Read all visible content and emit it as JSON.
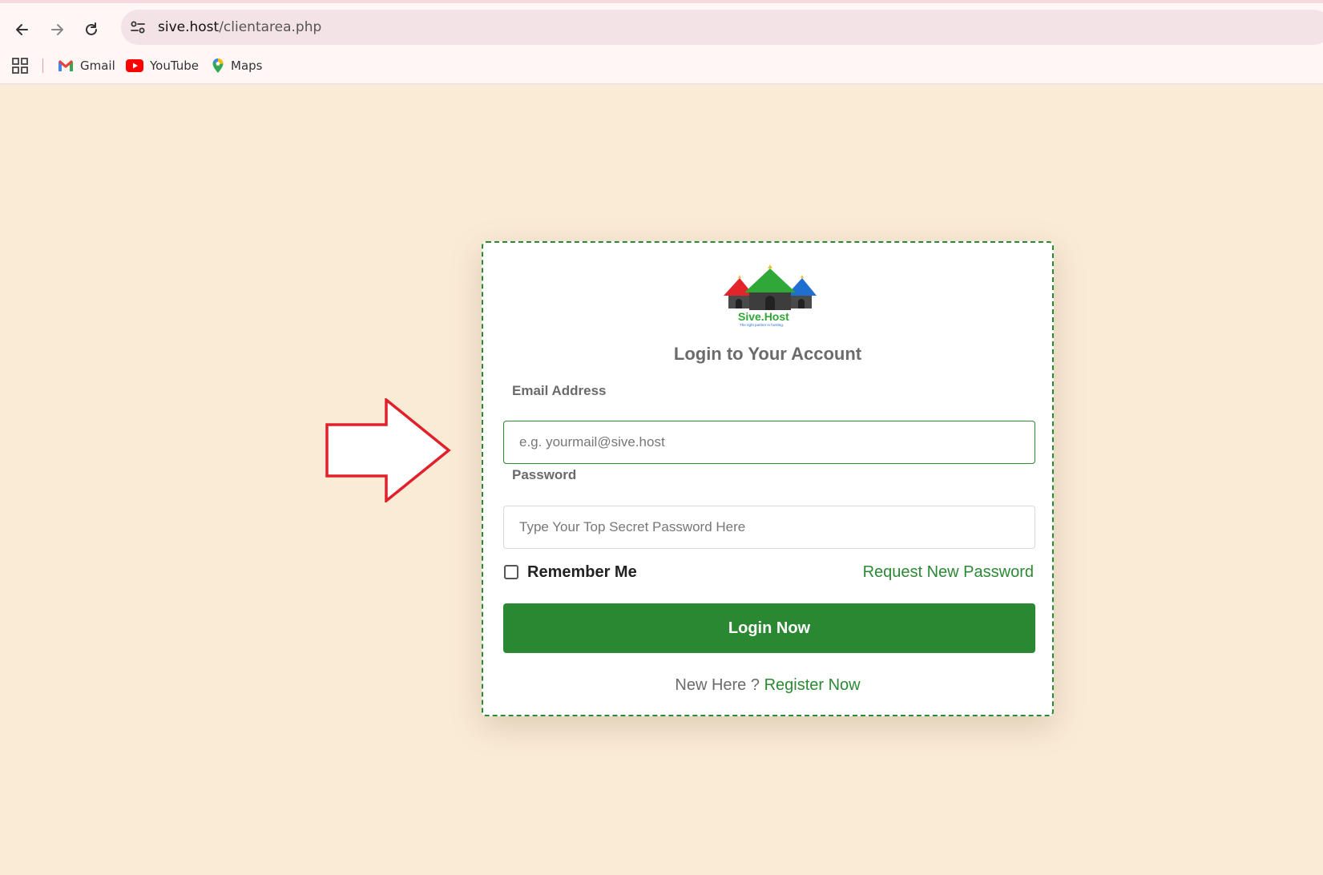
{
  "browser": {
    "url_host": "sive.host",
    "url_path": "/clientarea.php",
    "bookmarks": [
      {
        "label": "Gmail",
        "icon": "gmail-icon"
      },
      {
        "label": "YouTube",
        "icon": "youtube-icon"
      },
      {
        "label": "Maps",
        "icon": "maps-icon"
      }
    ]
  },
  "login": {
    "logo_text": "Sive.Host",
    "logo_tagline": "The right partner in hosting.",
    "title": "Login to Your Account",
    "email_label": "Email Address",
    "email_placeholder": "e.g. yourmail@sive.host",
    "password_label": "Password",
    "password_placeholder": "Type Your Top Secret Password Here",
    "remember_label": "Remember Me",
    "request_password": "Request New Password",
    "login_button": "Login Now",
    "new_here": "New Here ?",
    "register": "Register Now"
  },
  "colors": {
    "background": "#faebd7",
    "accent": "#2a8732",
    "annotation_arrow": "#e0202a"
  }
}
